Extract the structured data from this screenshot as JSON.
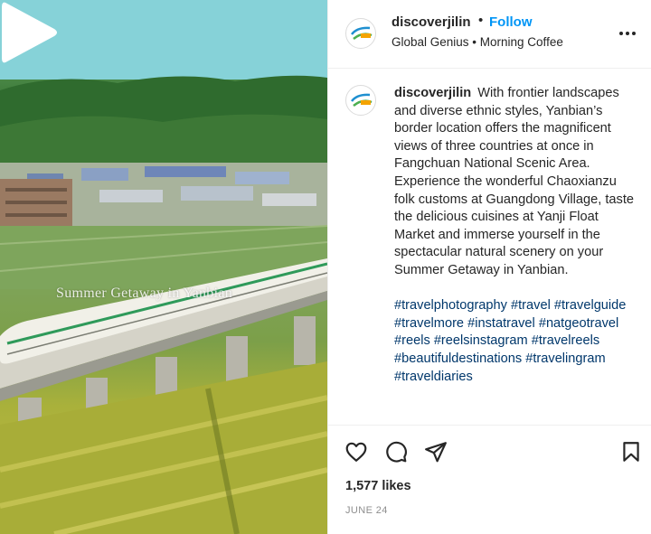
{
  "video": {
    "overlay_caption": "Summer Getaway in Yanbian",
    "play_icon": "play-icon"
  },
  "header": {
    "username": "discoverjilin",
    "separator": "•",
    "follow_label": "Follow",
    "audio": "Global Genius • Morning Coffee",
    "more_icon": "more-horizontal-icon"
  },
  "caption": {
    "username": "discoverjilin",
    "text": "With frontier landscapes and diverse ethnic styles, Yanbian’s border location offers the magnificent views of three countries at once in Fangchuan National Scenic Area. Experience the wonderful Chaoxianzu folk customs at Guangdong Village, taste the delicious cuisines at Yanji Float Market and immerse yourself in the spectacular natural scenery on your Summer Getaway in Yanbian.",
    "hashtags": [
      "#travelphotography",
      "#travel",
      "#travelguide",
      "#travelmore",
      "#instatravel",
      "#natgeotravel",
      "#reels",
      "#reelsinstagram",
      "#travelreels",
      "#beautifuldestinations",
      "#travelingram",
      "#traveldiaries"
    ]
  },
  "actions": {
    "like_icon": "heart-icon",
    "comment_icon": "comment-icon",
    "share_icon": "share-icon",
    "save_icon": "bookmark-icon",
    "likes": "1,577 likes",
    "date": "JUNE 24"
  },
  "colors": {
    "link": "#0095f6",
    "hashtag": "#00376b",
    "muted": "#8e8e8e",
    "text": "#262626"
  }
}
